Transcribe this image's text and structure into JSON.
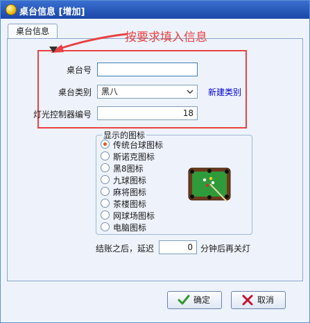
{
  "window": {
    "title": "桌台信息 [增加]"
  },
  "tab": {
    "label": "桌台信息"
  },
  "annotation": {
    "text": "按要求填入信息"
  },
  "form": {
    "table_no_label": "桌台号",
    "table_no_value": "",
    "category_label": "桌台类别",
    "category_value": "黑八",
    "new_category_link": "新建类别",
    "controller_label": "灯光控制器编号",
    "controller_value": "18"
  },
  "icon_group": {
    "title": "显示的图标",
    "options": [
      "传统台球图标",
      "斯诺克图标",
      "黑8图标",
      "九球图标",
      "麻将图标",
      "茶楼图标",
      "网球场图标",
      "电脑图标"
    ],
    "selected_index": 0
  },
  "delay": {
    "prefix": "结账之后，延迟",
    "value": "0",
    "suffix": "分钟后再关灯"
  },
  "buttons": {
    "ok": "确定",
    "cancel": "取消"
  },
  "colors": {
    "annotation_red": "#ea4141",
    "title_blue": "#1b47a8",
    "link_blue": "#0000cc"
  },
  "icons": [
    "app-icon",
    "billiard-table-icon",
    "check-icon",
    "cross-icon",
    "chevron-down-icon",
    "arrow-annotation-icon"
  ]
}
